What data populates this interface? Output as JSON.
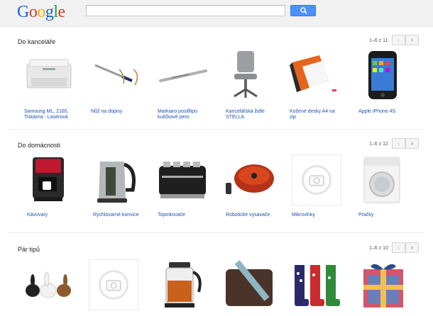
{
  "header": {
    "logo_text": "Google",
    "search_value": ""
  },
  "sections": [
    {
      "title": "Do kanceláře",
      "pager": "1–6 z 11",
      "products": [
        {
          "label_line1": "Samsung ML, 2165,",
          "label_line2": "Tiskárna - Laserová",
          "icon": "printer-icon"
        },
        {
          "label_line1": "Nůž na dopisy",
          "label_line2": "",
          "icon": "letter-opener-icon"
        },
        {
          "label_line1": "Markiaro posilllipo",
          "label_line2": "kuličkové pero",
          "icon": "pen-icon"
        },
        {
          "label_line1": "Kancelářská židle",
          "label_line2": "STELLA",
          "icon": "office-chair-icon"
        },
        {
          "label_line1": "Kožené desky A4 na",
          "label_line2": "zip",
          "icon": "leather-folder-icon"
        },
        {
          "label_line1": "Apple iPhone 4S",
          "label_line2": "",
          "icon": "phone-icon"
        }
      ]
    },
    {
      "title": "Do domácnosti",
      "pager": "1–6 z 12",
      "products": [
        {
          "label_line1": "Kávovary",
          "label_line2": "",
          "icon": "coffee-maker-icon"
        },
        {
          "label_line1": "Rychlovarné konvice",
          "label_line2": "",
          "icon": "kettle-icon"
        },
        {
          "label_line1": "Topinkovače",
          "label_line2": "",
          "icon": "toaster-icon"
        },
        {
          "label_line1": "Robotické vysavače",
          "label_line2": "",
          "icon": "robot-vacuum-icon"
        },
        {
          "label_line1": "Mikrovlnky",
          "label_line2": "",
          "icon": "camera-placeholder-icon"
        },
        {
          "label_line1": "Pračky",
          "label_line2": "",
          "icon": "washing-machine-icon"
        }
      ]
    },
    {
      "title": "Pár tipů",
      "pager": "1–6 z 10",
      "products": [
        {
          "label_line1": "",
          "label_line2": "",
          "icon": "rabbits-icon"
        },
        {
          "label_line1": "",
          "label_line2": "",
          "icon": "camera-placeholder-icon"
        },
        {
          "label_line1": "",
          "label_line2": "",
          "icon": "tea-kettle-icon"
        },
        {
          "label_line1": "",
          "label_line2": "",
          "icon": "laptop-bag-icon"
        },
        {
          "label_line1": "",
          "label_line2": "",
          "icon": "rain-boots-icon"
        },
        {
          "label_line1": "",
          "label_line2": "",
          "icon": "gift-box-icon"
        }
      ]
    }
  ],
  "pager_prev_symbol": "‹",
  "pager_next_symbol": "›"
}
